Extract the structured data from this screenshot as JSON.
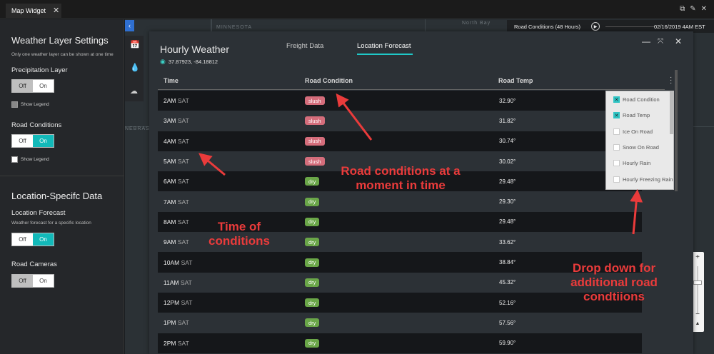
{
  "app": {
    "tab_title": "Map Widget",
    "tab_close": "✕",
    "top_icons": [
      "⧉",
      "✎",
      "✕"
    ]
  },
  "left": {
    "weather_heading": "Weather Layer Settings",
    "weather_sub": "Only one weather layer can be shown at one time",
    "precip_label": "Precipitation Layer",
    "toggle_off": "Off",
    "toggle_on": "On",
    "show_legend": "Show Legend",
    "road_cond_label": "Road Conditions",
    "location_heading": "Location-Specifc Data",
    "loc_forecast_label": "Location Forecast",
    "loc_forecast_sub": "Weather forecast for a specific location",
    "road_cameras_label": "Road Cameras"
  },
  "map": {
    "labels": [
      "MINNESOTA",
      "North Bay",
      "NEBRASKA"
    ],
    "collapse_icon": "‹",
    "strip_icons": [
      "📅",
      "💧",
      "☁"
    ]
  },
  "timebar": {
    "label": "Road Conditions (48 Hours)",
    "play_icon": "▶",
    "date": "02/16/2019 4AM EST"
  },
  "zoom": {
    "plus": "+",
    "minus": "−",
    "compass": "▲"
  },
  "panel": {
    "title": "Hourly Weather",
    "coords": "37.87923, -84.18812",
    "pin_icon": "◉",
    "tabs": [
      "Freight Data",
      "Location Forecast"
    ],
    "minimize": "—",
    "expand": "⤧",
    "close": "✕",
    "columns": [
      "Time",
      "Road Condition",
      "Road Temp"
    ],
    "rows": [
      {
        "hour": "2AM",
        "day": "SAT",
        "cond": "slush",
        "temp": "32.90°"
      },
      {
        "hour": "3AM",
        "day": "SAT",
        "cond": "slush",
        "temp": "31.82°"
      },
      {
        "hour": "4AM",
        "day": "SAT",
        "cond": "slush",
        "temp": "30.74°"
      },
      {
        "hour": "5AM",
        "day": "SAT",
        "cond": "slush",
        "temp": "30.02°"
      },
      {
        "hour": "6AM",
        "day": "SAT",
        "cond": "dry",
        "temp": "29.48°"
      },
      {
        "hour": "7AM",
        "day": "SAT",
        "cond": "dry",
        "temp": "29.30°"
      },
      {
        "hour": "8AM",
        "day": "SAT",
        "cond": "dry",
        "temp": "29.48°"
      },
      {
        "hour": "9AM",
        "day": "SAT",
        "cond": "dry",
        "temp": "33.62°"
      },
      {
        "hour": "10AM",
        "day": "SAT",
        "cond": "dry",
        "temp": "38.84°"
      },
      {
        "hour": "11AM",
        "day": "SAT",
        "cond": "dry",
        "temp": "45.32°"
      },
      {
        "hour": "12PM",
        "day": "SAT",
        "cond": "dry",
        "temp": "52.16°"
      },
      {
        "hour": "1PM",
        "day": "SAT",
        "cond": "dry",
        "temp": "57.56°"
      },
      {
        "hour": "2PM",
        "day": "SAT",
        "cond": "dry",
        "temp": "59.90°"
      }
    ],
    "dropdown": [
      {
        "label": "Road Condition",
        "checked": true
      },
      {
        "label": "Road Temp",
        "checked": true
      },
      {
        "label": "Ice On Road",
        "checked": false
      },
      {
        "label": "Snow On Road",
        "checked": false
      },
      {
        "label": "Hourly Rain",
        "checked": false
      },
      {
        "label": "Hourly Freezing Rain",
        "checked": false
      }
    ],
    "check_mark": "✕"
  },
  "annotations": {
    "road_conditions": "Road conditions at a moment in time",
    "time": "Time of conditions",
    "dropdown": "Drop down for additional road condtiions"
  },
  "colors": {
    "accent": "#1fc8c8",
    "slush": "#d46d7b",
    "dry": "#6aa648",
    "annotation": "#ea3b3b"
  }
}
